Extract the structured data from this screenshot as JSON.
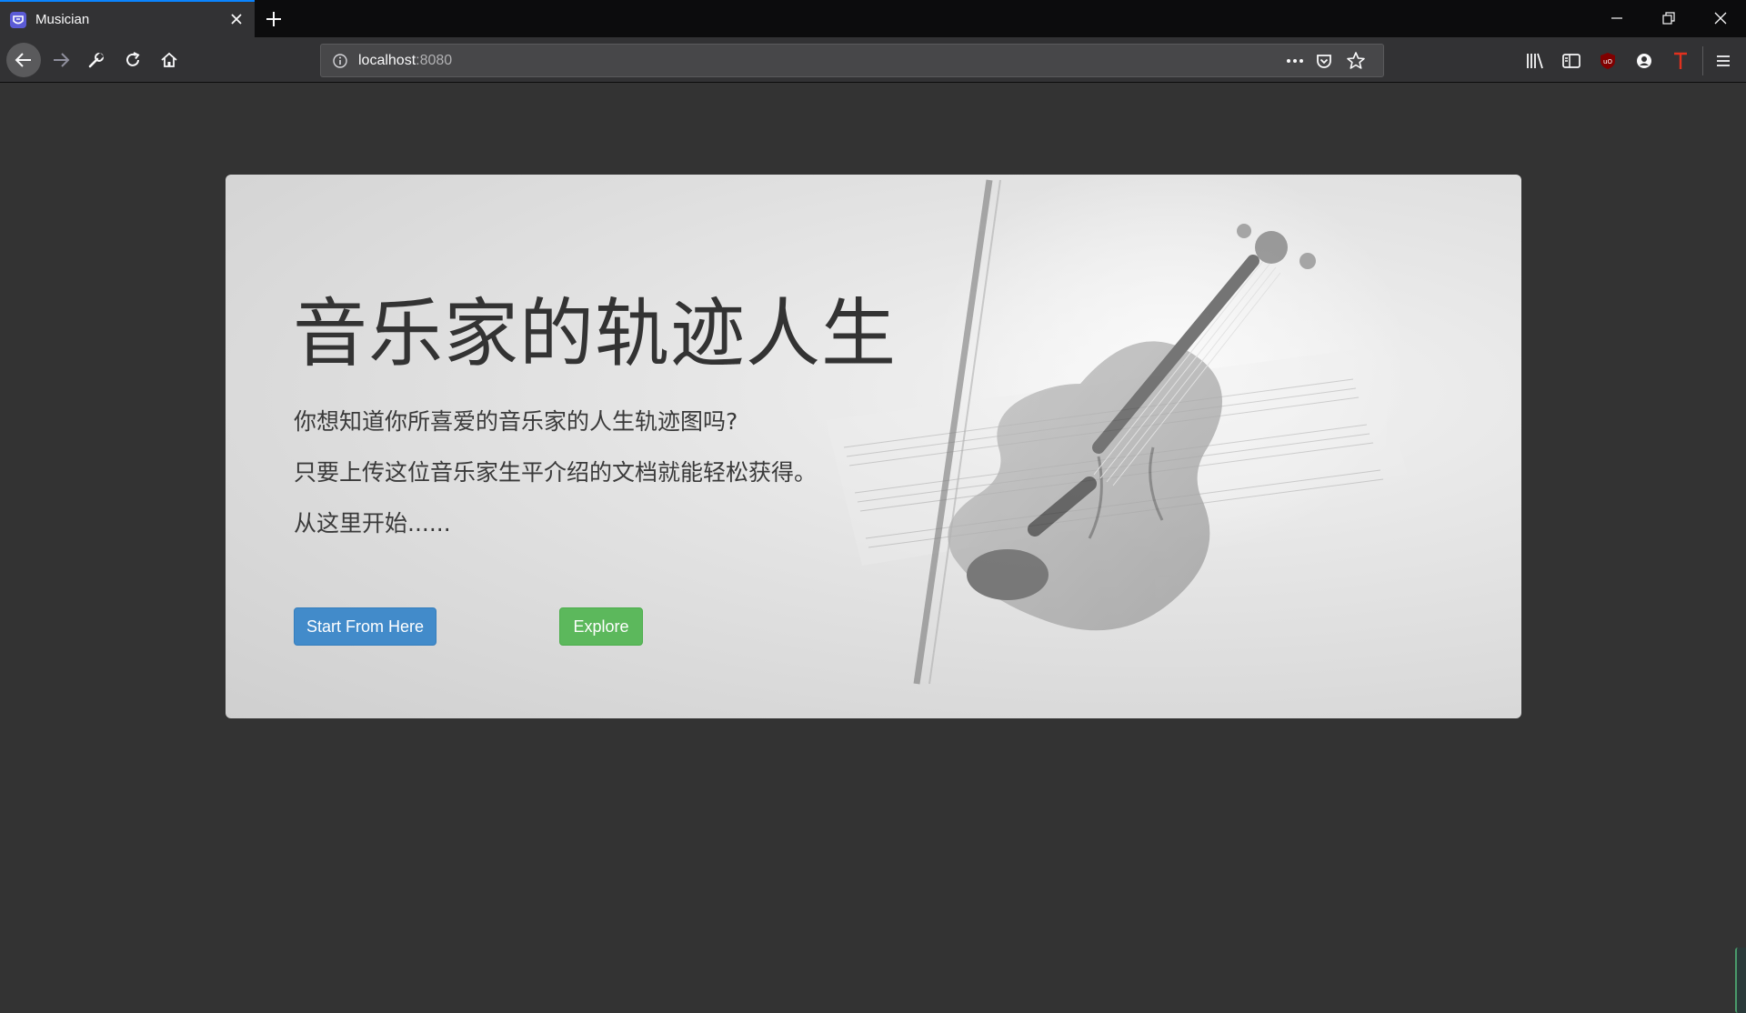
{
  "browser": {
    "tab": {
      "title": "Musician"
    },
    "url": {
      "host": "localhost",
      "port": ":8080"
    }
  },
  "hero": {
    "title": "音乐家的轨迹人生",
    "lines": [
      "你想知道你所喜爱的音乐家的人生轨迹图吗?",
      "只要上传这位音乐家生平介绍的文档就能轻松获得。",
      "从这里开始......"
    ],
    "buttons": {
      "start": "Start From Here",
      "explore": "Explore"
    }
  },
  "colors": {
    "primary": "#428bca",
    "success": "#5cb85c",
    "page_bg": "#333333",
    "tab_accent": "#0a84ff"
  }
}
